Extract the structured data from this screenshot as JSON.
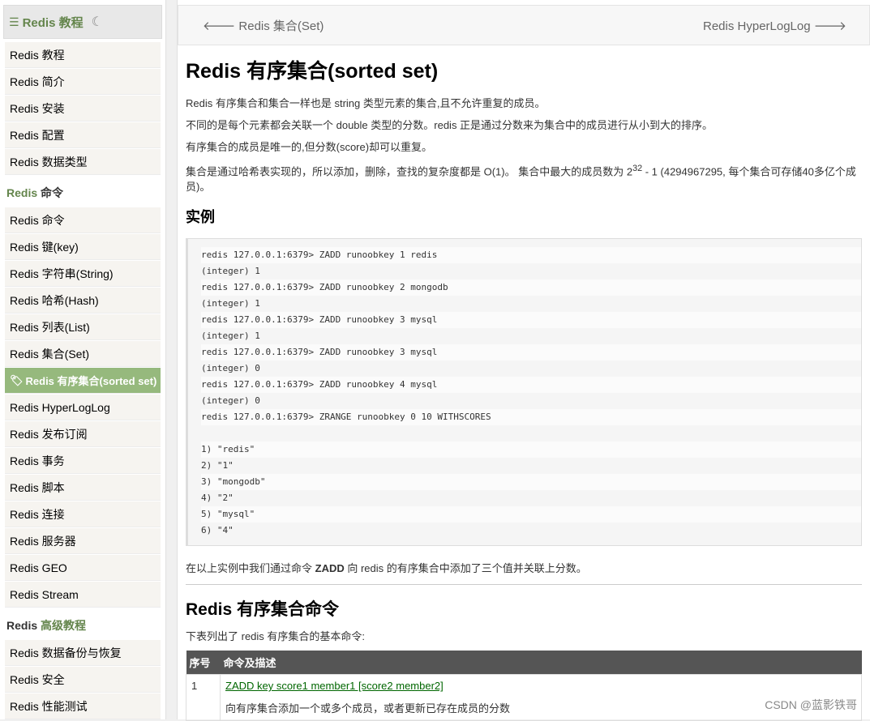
{
  "sidebar": {
    "title": "Redis 教程",
    "groups_first": [
      {
        "label": "Redis 教程"
      },
      {
        "label": "Redis 简介"
      },
      {
        "label": "Redis 安装"
      },
      {
        "label": "Redis 配置"
      },
      {
        "label": "Redis 数据类型"
      }
    ],
    "section_commands": {
      "pre": "Redis",
      "rest": " 命令"
    },
    "commands": [
      {
        "label": "Redis 命令"
      },
      {
        "label": "Redis 键(key)"
      },
      {
        "label": "Redis 字符串(String)"
      },
      {
        "label": "Redis 哈希(Hash)"
      },
      {
        "label": "Redis 列表(List)"
      },
      {
        "label": "Redis 集合(Set)"
      },
      {
        "label": "Redis 有序集合(sorted set)"
      },
      {
        "label": "Redis HyperLogLog"
      },
      {
        "label": "Redis 发布订阅"
      },
      {
        "label": "Redis 事务"
      },
      {
        "label": "Redis 脚本"
      },
      {
        "label": "Redis 连接"
      },
      {
        "label": "Redis 服务器"
      },
      {
        "label": "Redis GEO"
      },
      {
        "label": "Redis Stream"
      }
    ],
    "section_advanced": {
      "pre": "Redis",
      "rest": " 高级教程"
    },
    "advanced": [
      {
        "label": "Redis 数据备份与恢复"
      },
      {
        "label": "Redis 安全"
      },
      {
        "label": "Redis 性能测试"
      }
    ],
    "accent_color": "#64854c",
    "active_color": "#96b97d"
  },
  "nav": {
    "prev": "Redis 集合(Set)",
    "next": "Redis HyperLogLog"
  },
  "article": {
    "title": "Redis 有序集合(sorted set)",
    "p1": "Redis 有序集合和集合一样也是 string 类型元素的集合,且不允许重复的成员。",
    "p2": "不同的是每个元素都会关联一个 double 类型的分数。redis 正是通过分数来为集合中的成员进行从小到大的排序。",
    "p3": "有序集合的成员是唯一的,但分数(score)却可以重复。",
    "p4_pre": "集合是通过哈希表实现的，所以添加，删除，查找的复杂度都是 O(1)。 集合中最大的成员数为 2",
    "p4_sup": "32",
    "p4_post": " - 1 (4294967295, 每个集合可存储40多亿个成员)。",
    "example_heading": "实例",
    "code_lines": [
      "redis 127.0.0.1:6379> ZADD runoobkey 1 redis",
      "(integer) 1",
      "redis 127.0.0.1:6379> ZADD runoobkey 2 mongodb",
      "(integer) 1",
      "redis 127.0.0.1:6379> ZADD runoobkey 3 mysql",
      "(integer) 1",
      "redis 127.0.0.1:6379> ZADD runoobkey 3 mysql",
      "(integer) 0",
      "redis 127.0.0.1:6379> ZADD runoobkey 4 mysql",
      "(integer) 0",
      "redis 127.0.0.1:6379> ZRANGE runoobkey 0 10 WITHSCORES",
      "",
      "1) \"redis\"",
      "2) \"1\"",
      "3) \"mongodb\"",
      "4) \"2\"",
      "5) \"mysql\"",
      "6) \"4\""
    ],
    "after_example_pre": "在以上实例中我们通过命令 ",
    "after_example_bold": "ZADD",
    "after_example_post": " 向 redis 的有序集合中添加了三个值并关联上分数。",
    "commands_title": "Redis 有序集合命令",
    "commands_intro": "下表列出了 redis 有序集合的基本命令:",
    "table_headers": [
      "序号",
      "命令及描述"
    ],
    "table_rows": [
      {
        "num": "1",
        "cmd": "ZADD key score1 member1 [score2 member2]",
        "desc": "向有序集合添加一个或多个成员，或者更新已存在成员的分数"
      }
    ]
  },
  "watermark": "CSDN @蓝影铁哥"
}
